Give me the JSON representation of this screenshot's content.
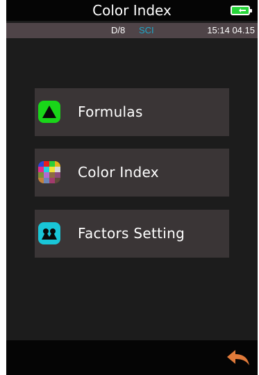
{
  "header": {
    "title": "Color Index",
    "battery_icon": "battery-charging-icon",
    "battery_color": "#27d63a"
  },
  "status": {
    "mode": "D/8",
    "sci": "SCI",
    "sci_color": "#1fa7c9",
    "time": "15:14 04.15"
  },
  "menu": {
    "items": [
      {
        "label": "Formulas",
        "icon": "formulas-triangle-icon",
        "color": "#19d619"
      },
      {
        "label": "Color Index",
        "icon": "color-index-palette-icon"
      },
      {
        "label": "Factors Setting",
        "icon": "factors-setting-icon",
        "color": "#19c6d8"
      }
    ]
  },
  "footer": {
    "back_icon": "back-arrow-icon",
    "back_color": "#e07a3a"
  }
}
